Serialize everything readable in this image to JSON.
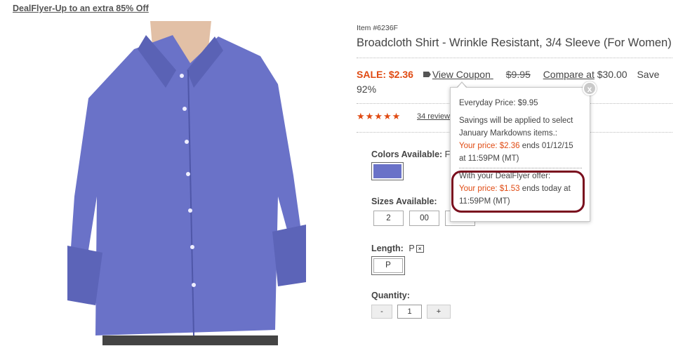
{
  "promo_link": "DealFlyer-Up to an extra 85% Off",
  "product": {
    "item_number": "Item #6236F",
    "title": "Broadcloth Shirt - Wrinkle Resistant, 3/4 Sleeve (For Women)",
    "image_label": "blue broadcloth shirt",
    "colors": {
      "accent": "#e04a12",
      "shirt": "#6a72c8",
      "highlight": "#7a0f1e"
    }
  },
  "pricing": {
    "sale_label": "SALE: $2.36",
    "view_coupon": "View Coupon",
    "original_price": "$9.95",
    "compare_label": "Compare at",
    "compare_price": "$30.00",
    "save_label": "Save",
    "save_pct": "92%"
  },
  "rating": {
    "stars": "★★★★★",
    "review_count": "34 review",
    "value": 4.5
  },
  "options": {
    "colors_label": "Colors Available:",
    "colors_value": "F",
    "sizes_label": "Sizes Available:",
    "sizes": [
      "2",
      "00"
    ],
    "length_label": "Length:",
    "length_value": "P",
    "length_option": "P",
    "quantity_label": "Quantity:",
    "qty_minus": "-",
    "qty_value": "1",
    "qty_plus": "+"
  },
  "popup": {
    "close": "x",
    "everyday_price": "Everyday Price: $9.95",
    "savings_line1": "Savings will be applied to select",
    "savings_line2": "January Markdowns items.:",
    "your_price_1_label": "Your price: $2.36",
    "your_price_1_rest": " ends 01/12/15",
    "your_price_1_time": "at 11:59PM (MT)",
    "dealflyer_line": "With your DealFlyer offer:",
    "your_price_2_label": "Your price: $1.53",
    "your_price_2_rest": " ends today at",
    "your_price_2_time": "11:59PM (MT)"
  }
}
